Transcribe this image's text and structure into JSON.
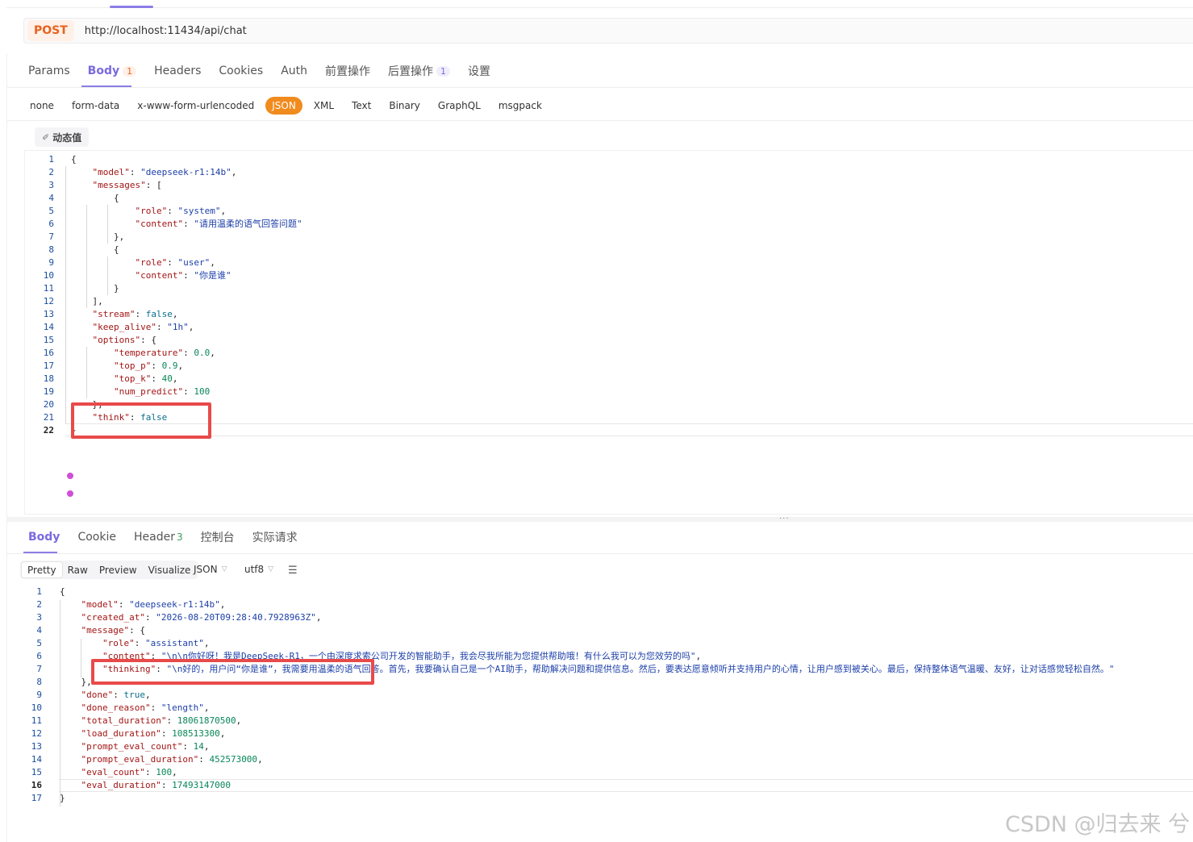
{
  "request": {
    "method": "POST",
    "url": "http://localhost:11434/api/chat",
    "tabs": [
      {
        "label": "Params",
        "badge": ""
      },
      {
        "label": "Body",
        "badge": "1"
      },
      {
        "label": "Headers",
        "badge": ""
      },
      {
        "label": "Cookies",
        "badge": ""
      },
      {
        "label": "Auth",
        "badge": ""
      },
      {
        "label": "前置操作",
        "badge": ""
      },
      {
        "label": "后置操作",
        "badge": "1"
      },
      {
        "label": "设置",
        "badge": ""
      }
    ],
    "active_tab": "Body",
    "body_types": [
      "none",
      "form-data",
      "x-www-form-urlencoded",
      "JSON",
      "XML",
      "Text",
      "Binary",
      "GraphQL",
      "msgpack"
    ],
    "active_body_type": "JSON",
    "dynamic_value_label": "动态值",
    "code": [
      {
        "n": "1",
        "indent": 0,
        "tokens": [
          [
            "p",
            "{"
          ]
        ]
      },
      {
        "n": "2",
        "indent": 1,
        "tokens": [
          [
            "k",
            "\"model\""
          ],
          [
            "p",
            ": "
          ],
          [
            "s",
            "\"deepseek-r1:14b\""
          ],
          [
            "p",
            ","
          ]
        ]
      },
      {
        "n": "3",
        "indent": 1,
        "tokens": [
          [
            "k",
            "\"messages\""
          ],
          [
            "p",
            ": ["
          ]
        ]
      },
      {
        "n": "4",
        "indent": 2,
        "tokens": [
          [
            "p",
            "{"
          ]
        ]
      },
      {
        "n": "5",
        "indent": 3,
        "tokens": [
          [
            "k",
            "\"role\""
          ],
          [
            "p",
            ": "
          ],
          [
            "s",
            "\"system\""
          ],
          [
            "p",
            ","
          ]
        ]
      },
      {
        "n": "6",
        "indent": 3,
        "tokens": [
          [
            "k",
            "\"content\""
          ],
          [
            "p",
            ": "
          ],
          [
            "s",
            "\"请用温柔的语气回答问题\""
          ]
        ]
      },
      {
        "n": "7",
        "indent": 2,
        "tokens": [
          [
            "p",
            "},"
          ]
        ]
      },
      {
        "n": "8",
        "indent": 2,
        "tokens": [
          [
            "p",
            "{"
          ]
        ]
      },
      {
        "n": "9",
        "indent": 3,
        "tokens": [
          [
            "k",
            "\"role\""
          ],
          [
            "p",
            ": "
          ],
          [
            "s",
            "\"user\""
          ],
          [
            "p",
            ","
          ]
        ]
      },
      {
        "n": "10",
        "indent": 3,
        "tokens": [
          [
            "k",
            "\"content\""
          ],
          [
            "p",
            ": "
          ],
          [
            "s",
            "\"你是谁\""
          ]
        ]
      },
      {
        "n": "11",
        "indent": 2,
        "tokens": [
          [
            "p",
            "}"
          ]
        ]
      },
      {
        "n": "12",
        "indent": 1,
        "tokens": [
          [
            "p",
            "],"
          ]
        ]
      },
      {
        "n": "13",
        "indent": 1,
        "tokens": [
          [
            "k",
            "\"stream\""
          ],
          [
            "p",
            ": "
          ],
          [
            "b",
            "false"
          ],
          [
            "p",
            ","
          ]
        ]
      },
      {
        "n": "14",
        "indent": 1,
        "tokens": [
          [
            "k",
            "\"keep_alive\""
          ],
          [
            "p",
            ": "
          ],
          [
            "s",
            "\"1h\""
          ],
          [
            "p",
            ","
          ]
        ]
      },
      {
        "n": "15",
        "indent": 1,
        "tokens": [
          [
            "k",
            "\"options\""
          ],
          [
            "p",
            ": {"
          ]
        ]
      },
      {
        "n": "16",
        "indent": 2,
        "tokens": [
          [
            "k",
            "\"temperature\""
          ],
          [
            "p",
            ": "
          ],
          [
            "n",
            "0.0"
          ],
          [
            "p",
            ","
          ]
        ]
      },
      {
        "n": "17",
        "indent": 2,
        "tokens": [
          [
            "k",
            "\"top_p\""
          ],
          [
            "p",
            ": "
          ],
          [
            "n",
            "0.9"
          ],
          [
            "p",
            ","
          ]
        ]
      },
      {
        "n": "18",
        "indent": 2,
        "tokens": [
          [
            "k",
            "\"top_k\""
          ],
          [
            "p",
            ": "
          ],
          [
            "n",
            "40"
          ],
          [
            "p",
            ","
          ]
        ]
      },
      {
        "n": "19",
        "indent": 2,
        "tokens": [
          [
            "k",
            "\"num_predict\""
          ],
          [
            "p",
            ": "
          ],
          [
            "n",
            "100"
          ]
        ]
      },
      {
        "n": "20",
        "indent": 1,
        "tokens": [
          [
            "p",
            "},"
          ]
        ]
      },
      {
        "n": "21",
        "indent": 1,
        "tokens": [
          [
            "k",
            "\"think\""
          ],
          [
            "p",
            ": "
          ],
          [
            "b",
            "false"
          ]
        ]
      },
      {
        "n": "22",
        "indent": 0,
        "tokens": [
          [
            "p",
            "}"
          ]
        ]
      }
    ],
    "current_line": "22"
  },
  "response": {
    "tabs": [
      {
        "label": "Body",
        "count": ""
      },
      {
        "label": "Cookie",
        "count": ""
      },
      {
        "label": "Header",
        "count": "3"
      },
      {
        "label": "控制台",
        "count": ""
      },
      {
        "label": "实际请求",
        "count": ""
      }
    ],
    "active_tab": "Body",
    "view_modes": [
      "Pretty",
      "Raw",
      "Preview",
      "Visualize"
    ],
    "active_view_mode": "Pretty",
    "format": "JSON",
    "encoding": "utf8",
    "code": [
      {
        "n": "1",
        "indent": 0,
        "tokens": [
          [
            "p",
            "{"
          ]
        ]
      },
      {
        "n": "2",
        "indent": 1,
        "tokens": [
          [
            "k",
            "\"model\""
          ],
          [
            "p",
            ": "
          ],
          [
            "s",
            "\"deepseek-r1:14b\""
          ],
          [
            "p",
            ","
          ]
        ]
      },
      {
        "n": "3",
        "indent": 1,
        "tokens": [
          [
            "k",
            "\"created_at\""
          ],
          [
            "p",
            ": "
          ],
          [
            "s",
            "\"2026-08-20T09:28:40.7928963Z\""
          ],
          [
            "p",
            ","
          ]
        ]
      },
      {
        "n": "4",
        "indent": 1,
        "tokens": [
          [
            "k",
            "\"message\""
          ],
          [
            "p",
            ": {"
          ]
        ]
      },
      {
        "n": "5",
        "indent": 2,
        "tokens": [
          [
            "k",
            "\"role\""
          ],
          [
            "p",
            ": "
          ],
          [
            "s",
            "\"assistant\""
          ],
          [
            "p",
            ","
          ]
        ]
      },
      {
        "n": "6",
        "indent": 2,
        "tokens": [
          [
            "k",
            "\"content\""
          ],
          [
            "p",
            ": "
          ],
          [
            "s",
            "\"\\n\\n你好呀！我是DeepSeek-R1，一个由深度求索公司开发的智能助手，我会尽我所能为您提供帮助哦！有什么我可以为您效劳的吗\""
          ],
          [
            "p",
            ","
          ]
        ]
      },
      {
        "n": "7",
        "indent": 2,
        "tokens": [
          [
            "k",
            "\"thinking\""
          ],
          [
            "p",
            ": "
          ],
          [
            "s",
            "\"\\n好的，用户问“你是谁”，我需要用温柔的语气回答。首先，我要确认自己是一个AI助手，帮助解决问题和提供信息。然后，要表达愿意倾听并支持用户的心情，让用户感到被关心。最后，保持整体语气温暖、友好，让对话感觉轻松自然。\""
          ]
        ]
      },
      {
        "n": "8",
        "indent": 1,
        "tokens": [
          [
            "p",
            "},"
          ]
        ]
      },
      {
        "n": "9",
        "indent": 1,
        "tokens": [
          [
            "k",
            "\"done\""
          ],
          [
            "p",
            ": "
          ],
          [
            "b",
            "true"
          ],
          [
            "p",
            ","
          ]
        ]
      },
      {
        "n": "10",
        "indent": 1,
        "tokens": [
          [
            "k",
            "\"done_reason\""
          ],
          [
            "p",
            ": "
          ],
          [
            "s",
            "\"length\""
          ],
          [
            "p",
            ","
          ]
        ]
      },
      {
        "n": "11",
        "indent": 1,
        "tokens": [
          [
            "k",
            "\"total_duration\""
          ],
          [
            "p",
            ": "
          ],
          [
            "n",
            "18061870500"
          ],
          [
            "p",
            ","
          ]
        ]
      },
      {
        "n": "12",
        "indent": 1,
        "tokens": [
          [
            "k",
            "\"load_duration\""
          ],
          [
            "p",
            ": "
          ],
          [
            "n",
            "108513300"
          ],
          [
            "p",
            ","
          ]
        ]
      },
      {
        "n": "13",
        "indent": 1,
        "tokens": [
          [
            "k",
            "\"prompt_eval_count\""
          ],
          [
            "p",
            ": "
          ],
          [
            "n",
            "14"
          ],
          [
            "p",
            ","
          ]
        ]
      },
      {
        "n": "14",
        "indent": 1,
        "tokens": [
          [
            "k",
            "\"prompt_eval_duration\""
          ],
          [
            "p",
            ": "
          ],
          [
            "n",
            "452573000"
          ],
          [
            "p",
            ","
          ]
        ]
      },
      {
        "n": "15",
        "indent": 1,
        "tokens": [
          [
            "k",
            "\"eval_count\""
          ],
          [
            "p",
            ": "
          ],
          [
            "n",
            "100"
          ],
          [
            "p",
            ","
          ]
        ]
      },
      {
        "n": "16",
        "indent": 1,
        "tokens": [
          [
            "k",
            "\"eval_duration\""
          ],
          [
            "p",
            ": "
          ],
          [
            "n",
            "17493147000"
          ]
        ]
      },
      {
        "n": "17",
        "indent": 0,
        "tokens": [
          [
            "p",
            "}"
          ]
        ]
      }
    ],
    "current_line": "16"
  },
  "watermark": "CSDN @归去来 兮",
  "colors": {
    "accent": "#7a6ae0",
    "method": "#e8631f",
    "json_active": "#f08b1d",
    "highlight_box": "#e84a4a"
  }
}
